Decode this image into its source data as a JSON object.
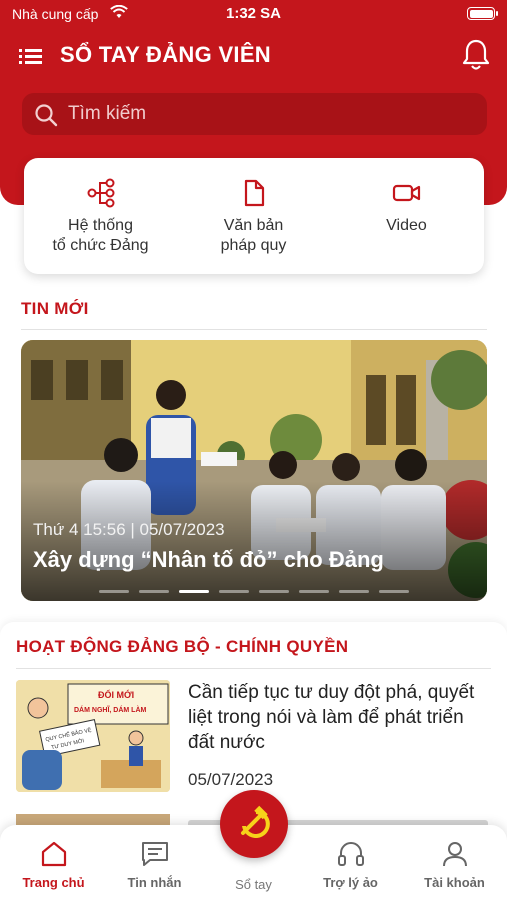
{
  "status_bar": {
    "carrier": "Nhà cung cấp",
    "time": "1:32 SA"
  },
  "header": {
    "title": "SỔ TAY ĐẢNG VIÊN"
  },
  "search": {
    "placeholder": "Tìm kiếm"
  },
  "quick_links": [
    {
      "label": "Hệ thống\ntổ chức Đảng",
      "icon": "org-tree-icon"
    },
    {
      "label": "Văn bản\npháp quy",
      "icon": "document-icon"
    },
    {
      "label": "Video",
      "icon": "video-camera-icon"
    }
  ],
  "news": {
    "section_title": "TIN MỚI",
    "featured": {
      "date": "Thứ 4 15:56 | 05/07/2023",
      "headline": "Xây dựng “Nhân tố đỏ” cho Đảng"
    },
    "carousel": {
      "count": 8,
      "active_index": 2
    }
  },
  "activities": {
    "section_title": "HOẠT ĐỘNG ĐẢNG BỘ - CHÍNH QUYỀN",
    "articles": [
      {
        "title": "Cần tiếp tục tư duy đột phá, quyết liệt trong nói và làm để phát triển đất nước",
        "date": "05/07/2023",
        "thumb_text": [
          "ĐỔI MỚI",
          "DÁM NGHĨ, DÁM LÀM",
          "QUY CHẾ BẢO VỆ",
          "TƯ DUY MỚI"
        ]
      }
    ]
  },
  "tabbar": {
    "items": [
      {
        "label": "Trang chủ",
        "icon": "home-icon",
        "active": true
      },
      {
        "label": "Tin nhắn",
        "icon": "message-icon",
        "active": false
      },
      {
        "label": "Sổ tay",
        "icon": "hammer-sickle-icon",
        "active": false
      },
      {
        "label": "Trợ lý ảo",
        "icon": "headset-icon",
        "active": false
      },
      {
        "label": "Tài khoản",
        "icon": "user-icon",
        "active": false
      }
    ]
  },
  "colors": {
    "primary": "#c4161c",
    "search_bg": "#a81217",
    "background": "#ffffff"
  }
}
